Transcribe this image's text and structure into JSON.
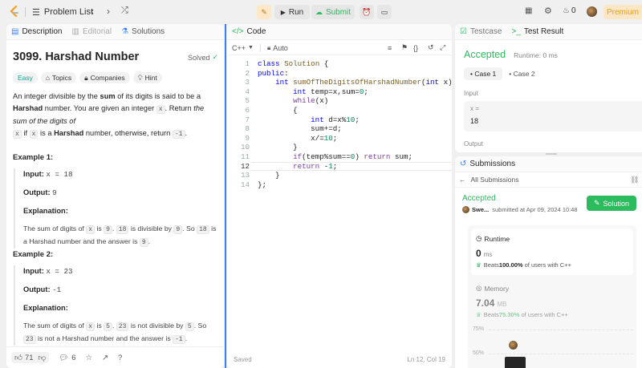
{
  "topbar": {
    "problem_list": "Problem List",
    "run": "Run",
    "submit": "Submit",
    "streak_count": "0",
    "premium": "Premium"
  },
  "left": {
    "tabs": [
      "Description",
      "Editorial",
      "Solutions"
    ],
    "title": "3099. Harshad Number",
    "solved": "Solved",
    "tags": [
      "Easy",
      "Topics",
      "Companies",
      "Hint"
    ],
    "statement": {
      "p1": "An integer divisible by the ",
      "p1_b1": "sum",
      "p1_b": " of its digits is said to be a ",
      "p1_b2": "Harshad",
      "p1_c": " number. You are given an integer ",
      "x": "x",
      "p1_d": ". Return ",
      "p1_i": "the sum of the digits of",
      "p1_e": " if ",
      "p1_f": " is a ",
      "p1_g": "Harshad",
      "p1_h": " number, otherwise, return ",
      "neg": "-1",
      "dot": "."
    },
    "example1": {
      "title": "Example 1:",
      "input_label": "Input:",
      "input": "x = 18",
      "output_label": "Output:",
      "output": "9",
      "explanation_label": "Explanation:",
      "expl_a": "The sum of digits of ",
      "expl_b": " is ",
      "v1": "9",
      "expl_c": ". ",
      "v2": "18",
      "expl_d": " is divisible by ",
      "expl_e": ". So ",
      "expl_f": " is a Harshad number and the answer is ",
      "expl_g": "."
    },
    "example2": {
      "title": "Example 2:",
      "input_label": "Input:",
      "input": "x = 23",
      "output_label": "Output:",
      "output": "-1",
      "explanation_label": "Explanation:",
      "expl_a": "The sum of digits of ",
      "expl_b": " is ",
      "v1": "5",
      "expl_c": ". ",
      "v2": "23",
      "expl_d": " is not divisible by ",
      "expl_e": ". So ",
      "expl_f": " is not a Harshad number and the answer is ",
      "v3": "-1",
      "expl_g": "."
    },
    "footer": {
      "likes": "71",
      "comments": "6"
    }
  },
  "code": {
    "tab": "Code",
    "lang": "C++",
    "auto": "Auto",
    "line_numbers": [
      "1",
      "2",
      "3",
      "4",
      "5",
      "6",
      "7",
      "8",
      "9",
      "10",
      "11",
      "12",
      "13",
      "14"
    ],
    "saved": "Saved",
    "cursor": "Ln 12, Col 19"
  },
  "testresult": {
    "tabs": [
      "Testcase",
      "Test Result"
    ],
    "status": "Accepted",
    "runtime": "Runtime: 0 ms",
    "cases": [
      "Case 1",
      "Case 2"
    ],
    "input_label": "Input",
    "var": "x =",
    "val": "18",
    "output_label": "Output"
  },
  "submissions": {
    "tab": "Submissions",
    "all": "All Submissions",
    "status": "Accepted",
    "user": "Swe...",
    "submitted": "submitted at Apr 09, 2024 10:48",
    "solution_btn": "Solution",
    "runtime_label": "Runtime",
    "runtime_val": "0",
    "runtime_unit": "ms",
    "beats_rt_a": "Beats ",
    "beats_rt_b": "100.00%",
    "beats_rt_c": " of users with C++",
    "memory_label": "Memory",
    "memory_val": "7.04",
    "memory_unit": "MB",
    "beats_mem_a": "Beats ",
    "beats_mem_b": "75.30%",
    "beats_mem_c": " of users with C++",
    "y75": "75%",
    "y50": "50%"
  },
  "colors": {
    "accent_green": "#2cbb5d",
    "easy": "#00af9b",
    "orange": "#ffa116",
    "blue_line": "#3b82f6"
  }
}
